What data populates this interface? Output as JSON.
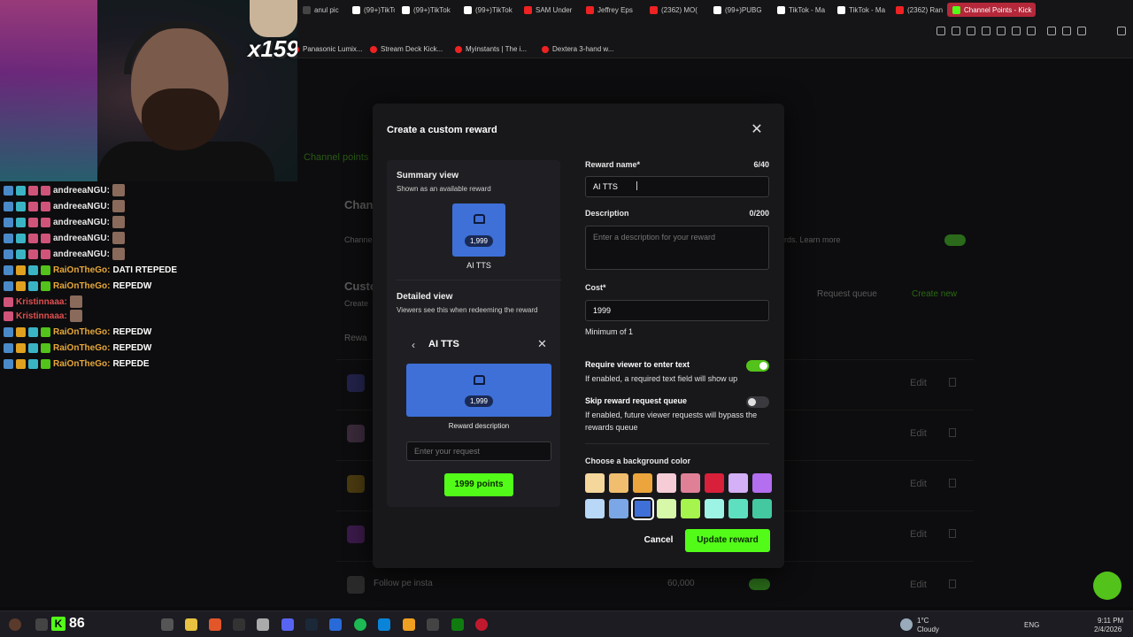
{
  "browser": {
    "tabs": [
      {
        "label": "anul pic",
        "color": "#444"
      },
      {
        "label": "(99+)TikTok",
        "color": "#fff"
      },
      {
        "label": "(99+)TikTok",
        "color": "#fff"
      },
      {
        "label": "(99+)TikTok",
        "color": "#fff"
      },
      {
        "label": "SAM Under",
        "color": "#e22"
      },
      {
        "label": "Jeffrey Eps",
        "color": "#e22"
      },
      {
        "label": "(2362) MO(",
        "color": "#e22"
      },
      {
        "label": "(99+)PUBG",
        "color": "#fff"
      },
      {
        "label": "TikTok - Ma",
        "color": "#fff"
      },
      {
        "label": "TikTok - Ma",
        "color": "#fff"
      },
      {
        "label": "(2362) Ran",
        "color": "#e22"
      },
      {
        "label": "Channel Points - Kick",
        "color": "#53fc18"
      }
    ],
    "bookmarks": [
      "Panasonic Lumix...",
      "Stream Deck Kick...",
      "Myinstants | The i...",
      "Dextera 3-hand w..."
    ]
  },
  "overlay": {
    "counter": "x159",
    "chat": [
      {
        "name": "andreeaNGU:",
        "msg": "",
        "style": "normal"
      },
      {
        "name": "andreeaNGU:",
        "msg": "",
        "style": "normal"
      },
      {
        "name": "andreeaNGU:",
        "msg": "",
        "style": "normal"
      },
      {
        "name": "andreeaNGU:",
        "msg": "",
        "style": "normal"
      },
      {
        "name": "andreeaNGU:",
        "msg": "",
        "style": "normal"
      },
      {
        "name": "RaiOnTheGo:",
        "msg": "DATI RTEPEDE",
        "style": "gold"
      },
      {
        "name": "RaiOnTheGo:",
        "msg": "REPEDW",
        "style": "gold"
      },
      {
        "name": "Kristinnaaa:",
        "msg": "",
        "style": "red"
      },
      {
        "name": "Kristinnaaa:",
        "msg": "",
        "style": "red"
      },
      {
        "name": "RaiOnTheGo:",
        "msg": "REPEDW",
        "style": "gold"
      },
      {
        "name": "RaiOnTheGo:",
        "msg": "REPEDW",
        "style": "gold"
      },
      {
        "name": "RaiOnTheGo:",
        "msg": "REPEDE",
        "style": "gold"
      }
    ]
  },
  "background_page": {
    "nav_fragment": "lges",
    "nav_active": "Channel points",
    "section_title": "Chan",
    "section_sub": "Channe",
    "learn_more": "rds. Learn more",
    "custom_title": "Custo",
    "custom_sub": "Create",
    "col_header": "Rewa",
    "request_queue": "Request queue",
    "create_new": "Create new",
    "edit_label": "Edit",
    "last_row_name": "Follow pe insta",
    "last_row_cost": "60,000"
  },
  "modal": {
    "title": "Create a custom reward",
    "summary": {
      "heading": "Summary view",
      "sub": "Shown as an available reward",
      "tile_cost": "1,999",
      "tile_label": "AI TTS"
    },
    "detailed": {
      "heading": "Detailed view",
      "sub": "Viewers see this when redeeming the reward",
      "title": "AI TTS",
      "tile_cost": "1,999",
      "desc": "Reward description",
      "input_placeholder": "Enter your request",
      "points_button": "1999 points"
    },
    "form": {
      "name_label": "Reward name*",
      "name_count": "6/40",
      "name_value": "AI TTS",
      "desc_label": "Description",
      "desc_count": "0/200",
      "desc_placeholder": "Enter a description for your reward",
      "cost_label": "Cost*",
      "cost_value": "1999",
      "cost_hint": "Minimum of 1",
      "require_text_title": "Require viewer to enter text",
      "require_text_desc": "If enabled, a required text field will show up",
      "require_text_on": true,
      "skip_queue_title": "Skip reward request queue",
      "skip_queue_desc": "If enabled, future viewer requests will bypass the rewards queue",
      "skip_queue_on": false,
      "color_label": "Choose a background color",
      "colors_row1": [
        "#f6d79b",
        "#f0be6e",
        "#eba53c",
        "#f6cdd6",
        "#e08096",
        "#d8203a",
        "#d4b0f6",
        "#b46ef0"
      ],
      "colors_row2": [
        "#b9d7f6",
        "#7ba7e6",
        "#3e70d8",
        "#d6f8a8",
        "#a6f44e",
        "#9ef4e4",
        "#5ee0c0",
        "#44c8a0"
      ],
      "selected_color": "#3e70d8",
      "cancel": "Cancel",
      "submit": "Update reward"
    }
  },
  "taskbar": {
    "kick_count": "86",
    "weather_temp": "1°C",
    "weather_desc": "Cloudy",
    "lang": "ENG",
    "time": "9:11 PM",
    "date": "2/4/2026"
  }
}
